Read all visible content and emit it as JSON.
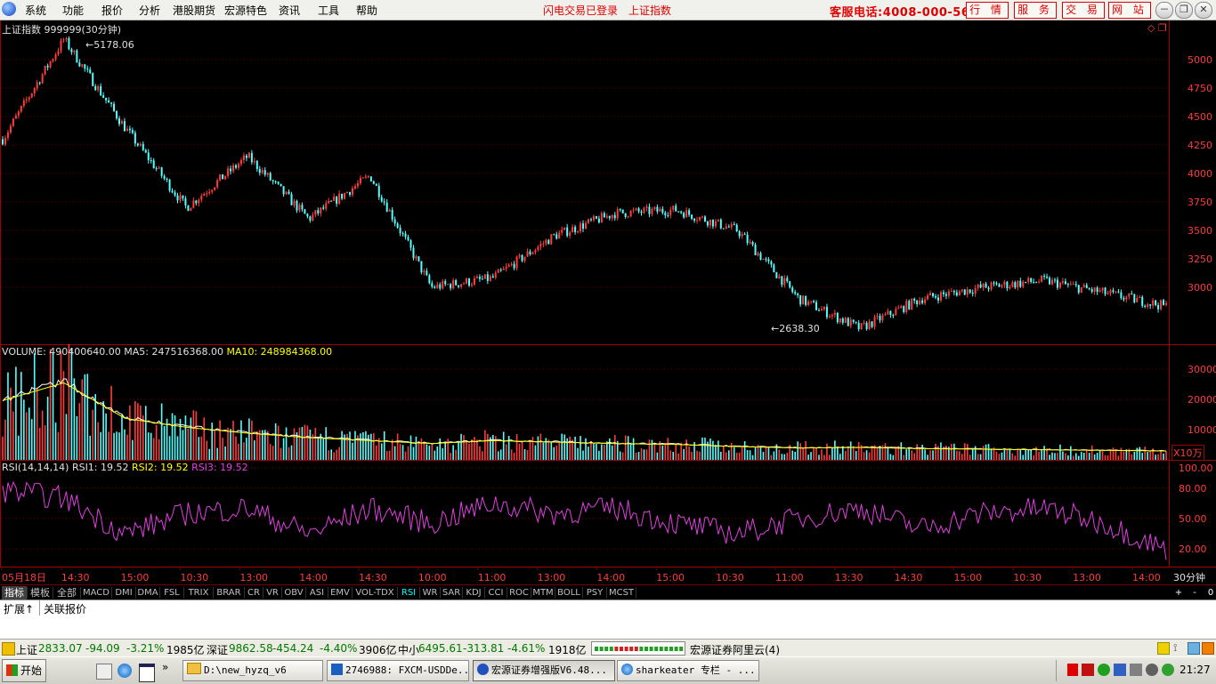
{
  "menubar": {
    "items": [
      "系统",
      "功能",
      "报价",
      "分析",
      "港股期货",
      "宏源特色",
      "资讯",
      "工具",
      "帮助"
    ],
    "status_login": "闪电交易已登录",
    "status_index": "上证指数",
    "hotline": "客服电话:4008-000-562",
    "buttons": [
      "行 情",
      "服 务",
      "交 易",
      "网 站"
    ],
    "window_controls": {
      "minimize": "－",
      "restore": "❐",
      "close": "✕"
    }
  },
  "chart": {
    "title": "上证指数 999999(30分钟)",
    "high_marker": "5178.06",
    "low_marker": "2638.30",
    "price_axis": [
      "5000",
      "4750",
      "4500",
      "4250",
      "4000",
      "3750",
      "3500",
      "3250",
      "3000"
    ],
    "volume_legend": {
      "label": "VOLUME: 490400640.00",
      "ma5": "MA5: 247516368.00",
      "ma10": "MA10: 248984368.00"
    },
    "volume_axis": [
      "30000",
      "20000",
      "10000"
    ],
    "volume_unit": "X10万",
    "rsi_legend": {
      "label": "RSI(14,14,14)",
      "rsi1": "RSI1: 19.52",
      "rsi2": "RSI2: 19.52",
      "rsi3": "RSI3: 19.52"
    },
    "rsi_axis": [
      "100.00",
      "80.00",
      "50.00",
      "20.00"
    ],
    "time_labels": [
      "05月18日",
      "14:30",
      "15:00",
      "10:30",
      "13:00",
      "14:00",
      "14:30",
      "10:00",
      "11:00",
      "13:00",
      "14:00",
      "15:00",
      "10:30",
      "11:00",
      "13:30",
      "14:30",
      "15:00",
      "10:30",
      "13:00",
      "14:00"
    ],
    "period": "30分钟",
    "colors": {
      "up": "#ff3c3c",
      "down": "#54ffff",
      "rsi": "#e040e0",
      "ma5": "#ffffff",
      "ma10": "#ffff00",
      "grid": "#800000",
      "axis_text": "#ff3c3c"
    }
  },
  "chart_data": {
    "type": "line",
    "title": "上证指数 999999(30分钟)",
    "xlabel": "",
    "ylabel": "",
    "ylim": [
      2500,
      5300
    ],
    "x": [
      "05月18日",
      "14:30",
      "15:00",
      "10:30",
      "13:00",
      "14:00",
      "14:30",
      "10:00",
      "11:00",
      "13:00",
      "14:00",
      "15:00",
      "10:30",
      "11:00",
      "13:30",
      "14:30",
      "15:00",
      "10:30",
      "13:00",
      "14:00"
    ],
    "series": [
      {
        "name": "上证指数",
        "values": [
          4300,
          5178.06,
          4400,
          3700,
          4150,
          3600,
          3980,
          3000,
          3080,
          3450,
          3650,
          3680,
          3500,
          2900,
          2638.3,
          2900,
          3000,
          3060,
          2950,
          2833.07
        ]
      },
      {
        "name": "VOLUME",
        "values": [
          20000,
          26000,
          14000,
          11000,
          9000,
          7500,
          6500,
          5500,
          6500,
          6000,
          5500,
          5200,
          4500,
          4000,
          4200,
          3800,
          3600,
          3400,
          3200,
          3000
        ]
      },
      {
        "name": "RSI1",
        "values": [
          78,
          70,
          35,
          55,
          60,
          35,
          60,
          45,
          65,
          55,
          60,
          45,
          35,
          50,
          60,
          40,
          55,
          60,
          45,
          19.52
        ]
      }
    ]
  },
  "tabbar": {
    "tabs": [
      "指标",
      "模板",
      "全部",
      "MACD",
      "DMI",
      "DMA",
      "FSL",
      "TRIX",
      "BRAR",
      "CR",
      "VR",
      "OBV",
      "ASI",
      "EMV",
      "VOL-TDX",
      "RSI",
      "WR",
      "SAR",
      "KDJ",
      "CCI",
      "ROC",
      "MTM",
      "BOLL",
      "PSY",
      "MCST"
    ],
    "right": [
      "+",
      "-",
      "0"
    ]
  },
  "ext": {
    "expand": "扩展↑",
    "related": "关联报价"
  },
  "status": {
    "sh_label": "上证",
    "sh_value": "2833.07",
    "sh_change": "-94.09",
    "sh_pct": "-3.21%",
    "sh_amt": "1985亿",
    "sz_label": "深证",
    "sz_value": "9862.58",
    "sz_change": "-454.24",
    "sz_pct": "-4.40%",
    "sz_amt": "3906亿",
    "zx_label": "中小",
    "zx_value": "6495.61",
    "zx_change": "-313.81",
    "zx_pct": "-4.61%",
    "zx_amt": "1918亿",
    "server": "宏源证券阿里云(4)"
  },
  "taskbar": {
    "start": "开始",
    "tasks": [
      "D:\\new_hyzq_v6",
      "2746988: FXCM-USDDe...",
      "宏源证券增强版V6.48...",
      "sharkeater 专栏 - ..."
    ],
    "clock": "21:27"
  }
}
